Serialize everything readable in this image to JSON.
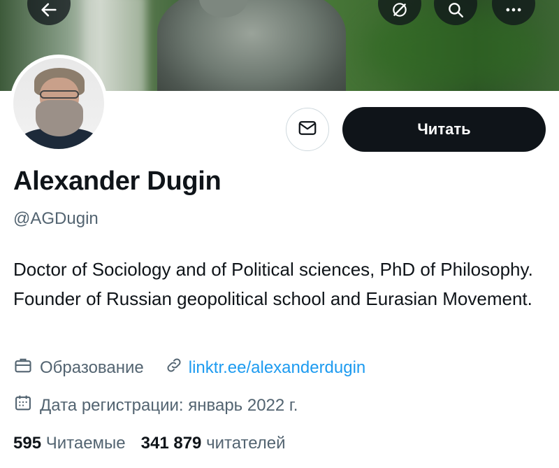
{
  "header": {
    "back_icon": "arrow-left-icon",
    "grok_icon": "grok-icon",
    "search_icon": "search-icon",
    "more_icon": "more-horizontal-icon"
  },
  "profile": {
    "name": "Alexander Dugin",
    "handle": "@AGDugin",
    "bio": "Doctor of Sociology and of Political sciences, PhD of Philosophy. Founder of Russian geopolitical school and Eurasian Movement.",
    "category": "Образование",
    "link": "linktr.ee/alexanderdugin",
    "joined": "Дата регистрации: январь 2022 г.",
    "following_count": "595",
    "following_label": "Читаемые",
    "followers_count": "341 879",
    "followers_label": "читателей"
  },
  "actions": {
    "follow_label": "Читать",
    "message_icon": "envelope-icon"
  },
  "colors": {
    "primary_text": "#0f1419",
    "secondary_text": "#536471",
    "link": "#1d9bf0",
    "button_bg": "#0f1419"
  }
}
